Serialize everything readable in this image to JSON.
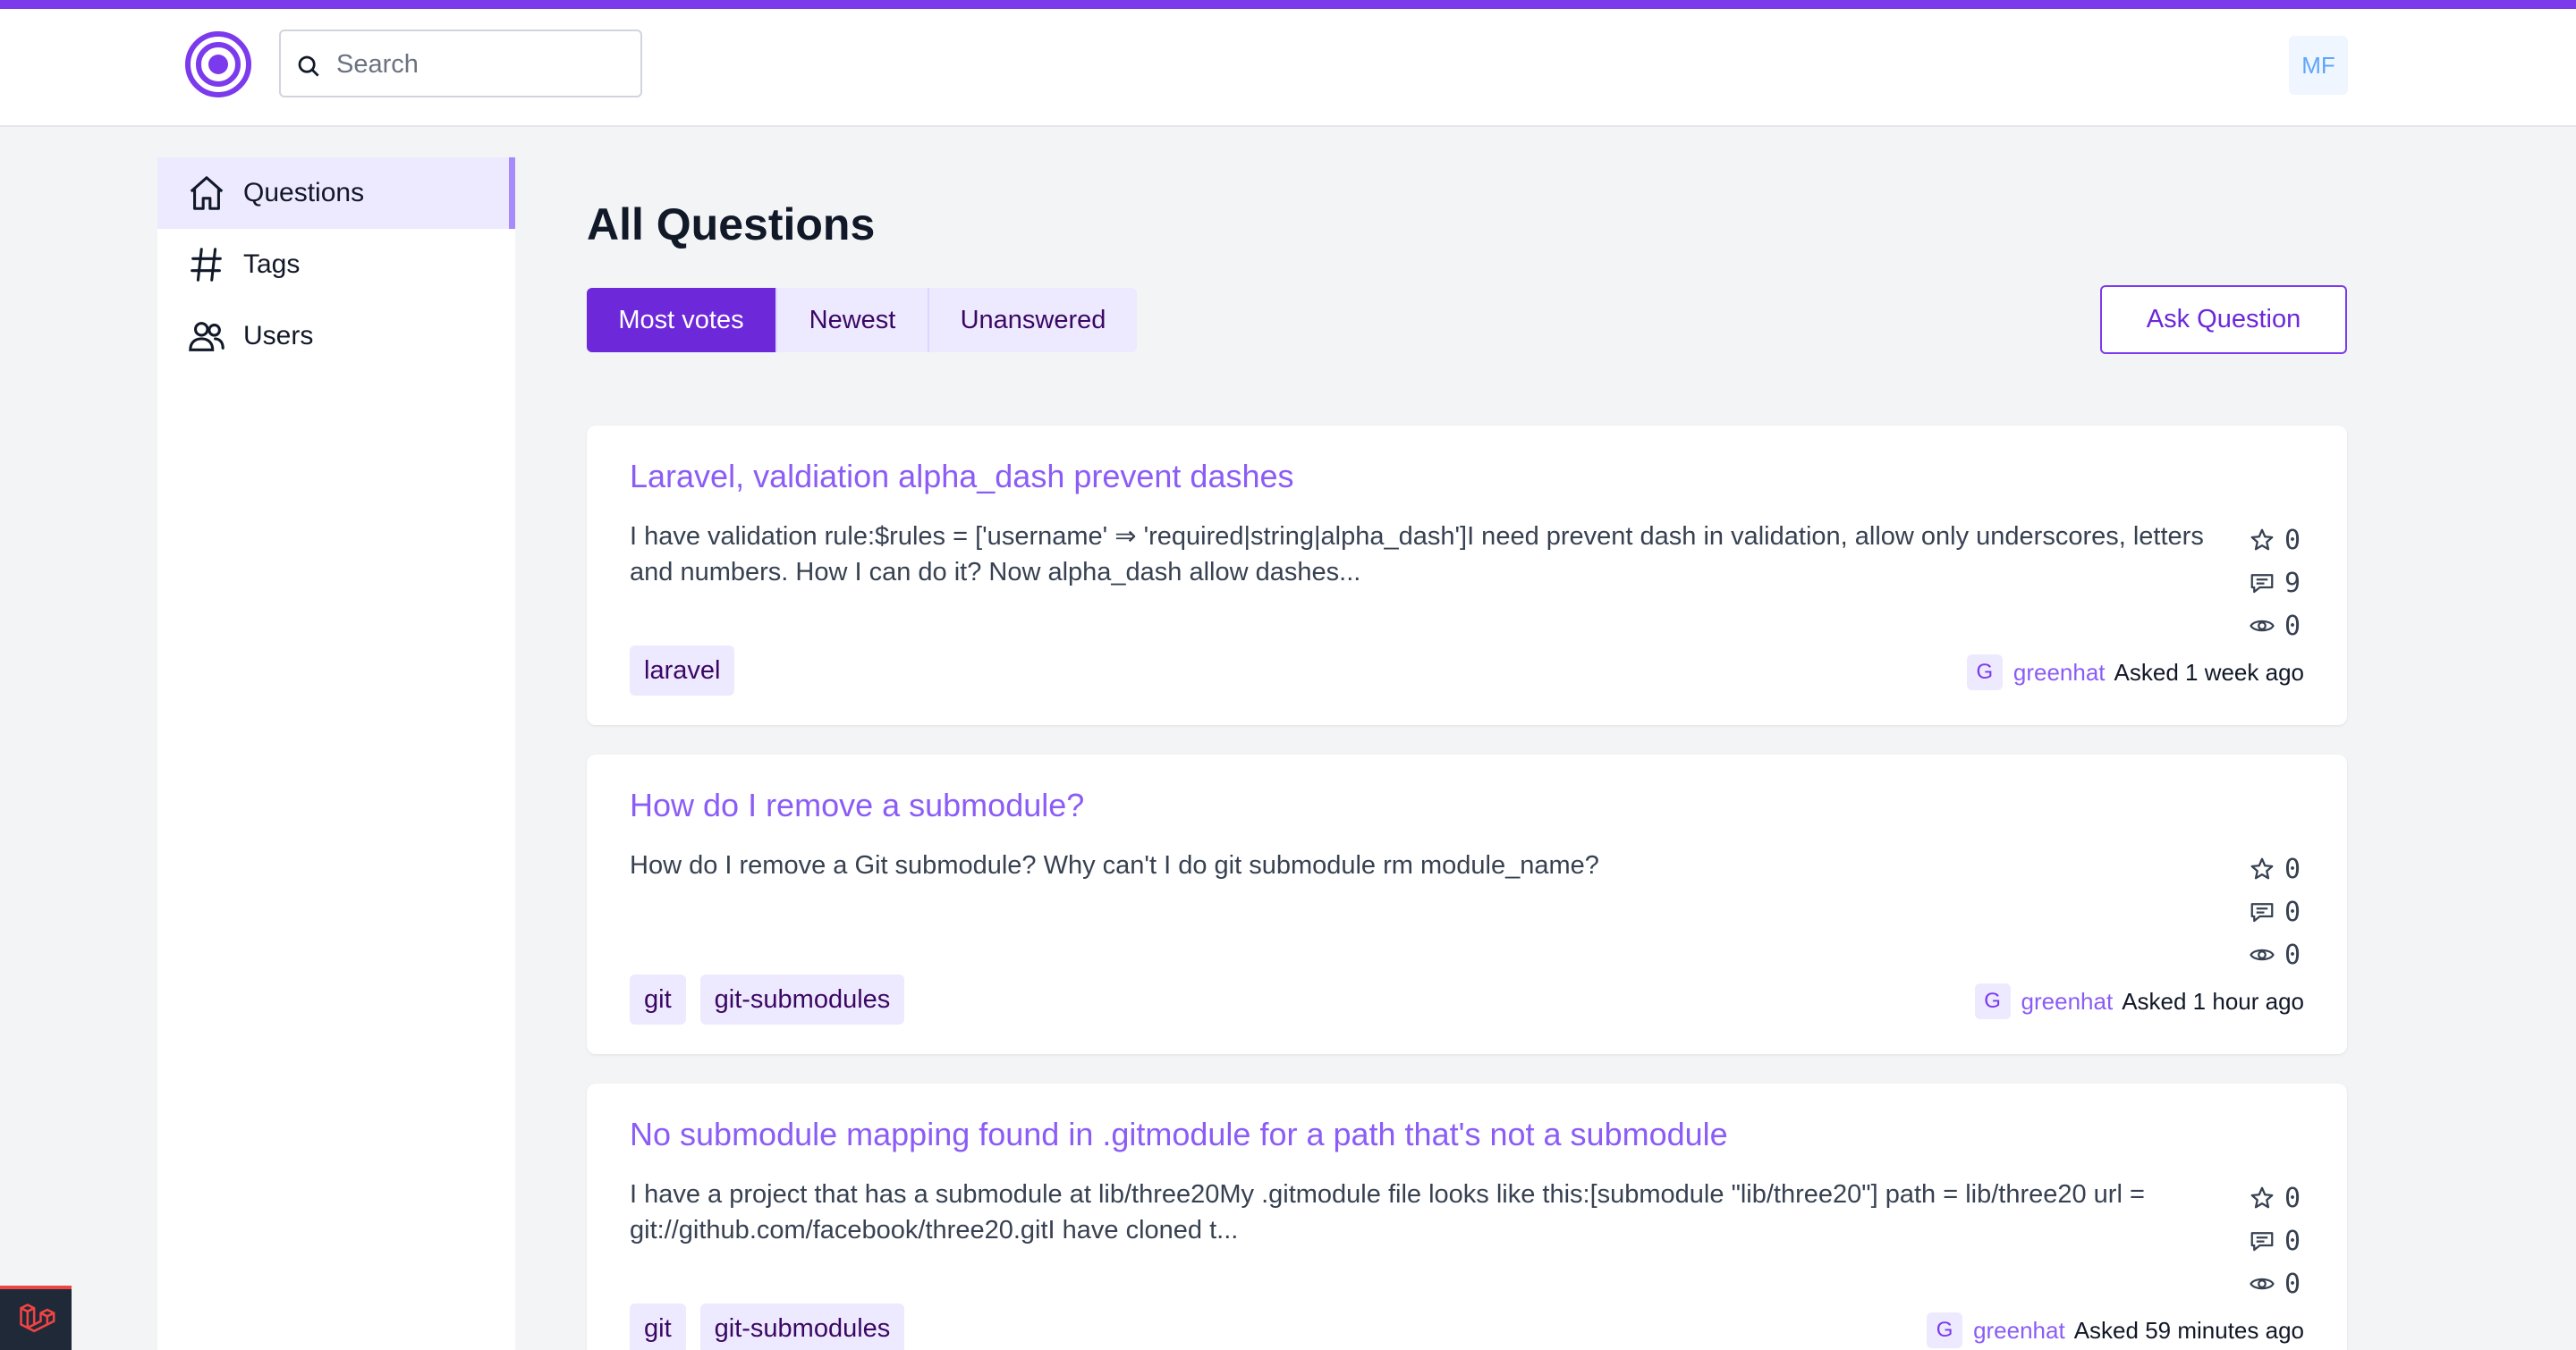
{
  "colors": {
    "accent": "#7c3aed",
    "link": "#8b5cf6",
    "tag_bg": "#ede9fe"
  },
  "header": {
    "search": {
      "placeholder": "Search",
      "icon": "search-icon"
    },
    "user_initials": "MF"
  },
  "sidebar": {
    "items": [
      {
        "label": "Questions",
        "icon": "home-icon",
        "active": true
      },
      {
        "label": "Tags",
        "icon": "hash-icon",
        "active": false
      },
      {
        "label": "Users",
        "icon": "users-icon",
        "active": false
      }
    ]
  },
  "main": {
    "title": "All Questions",
    "tabs": [
      {
        "label": "Most votes",
        "active": true
      },
      {
        "label": "Newest",
        "active": false
      },
      {
        "label": "Unanswered",
        "active": false
      }
    ],
    "ask_button": "Ask Question"
  },
  "questions": [
    {
      "title": "Laravel, valdiation alpha_dash prevent dashes",
      "excerpt": "I have validation rule:$rules = ['username' ⇒ 'required|string|alpha_dash']I need prevent dash in validation, allow only underscores, letters and numbers. How I can do it? Now alpha_dash allow dashes...",
      "votes": "0",
      "answers": "9",
      "views": "0",
      "tags": [
        "laravel"
      ],
      "author_initial": "G",
      "author": "greenhat",
      "asked": "Asked 1 week ago"
    },
    {
      "title": "How do I remove a submodule?",
      "excerpt": "How do I remove a Git submodule? Why can't I do git submodule rm module_name?",
      "votes": "0",
      "answers": "0",
      "views": "0",
      "tags": [
        "git",
        "git-submodules"
      ],
      "author_initial": "G",
      "author": "greenhat",
      "asked": "Asked 1 hour ago"
    },
    {
      "title": "No submodule mapping found in .gitmodule for a path that's not a submodule",
      "excerpt": "I have a project that has a submodule at lib/three20My .gitmodule file looks like this:[submodule \"lib/three20\"] path = lib/three20 url = git://github.com/facebook/three20.gitI have cloned t...",
      "votes": "0",
      "answers": "0",
      "views": "0",
      "tags": [
        "git",
        "git-submodules"
      ],
      "author_initial": "G",
      "author": "greenhat",
      "asked": "Asked 59 minutes ago"
    }
  ]
}
